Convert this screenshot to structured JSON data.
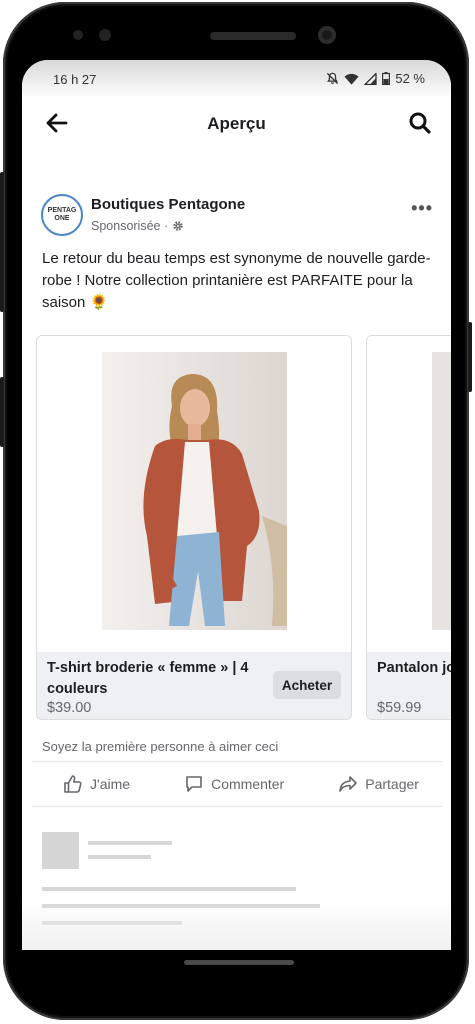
{
  "status": {
    "time": "16 h 27",
    "battery": "52 %"
  },
  "appbar": {
    "title": "Aperçu"
  },
  "post": {
    "avatar_text_line1": "PENTAG",
    "avatar_text_line2": "ONE",
    "page_name": "Boutiques Pentagone",
    "sponsored_label": "Sponsorisée ·",
    "text": "Le retour du beau temps est synonyme de nouvelle garde-robe ! Notre collection printanière est PARFAITE pour la saison 🌻"
  },
  "products": [
    {
      "name": "T-shirt broderie « femme » | 4 couleurs",
      "price": "$39.00",
      "button": "Acheter"
    },
    {
      "name": "Pantalon jo… Fabriqué au…",
      "price": "$59.99"
    }
  ],
  "engagement": {
    "likes_text": "Soyez la première personne à aimer ceci"
  },
  "actions": {
    "like": "J'aime",
    "comment": "Commenter",
    "share": "Partager"
  },
  "colors": {
    "accent": "#4a86c8",
    "muted_text": "#65676b",
    "card_info_bg": "#eef0f3",
    "button_bg": "#dadde1"
  }
}
